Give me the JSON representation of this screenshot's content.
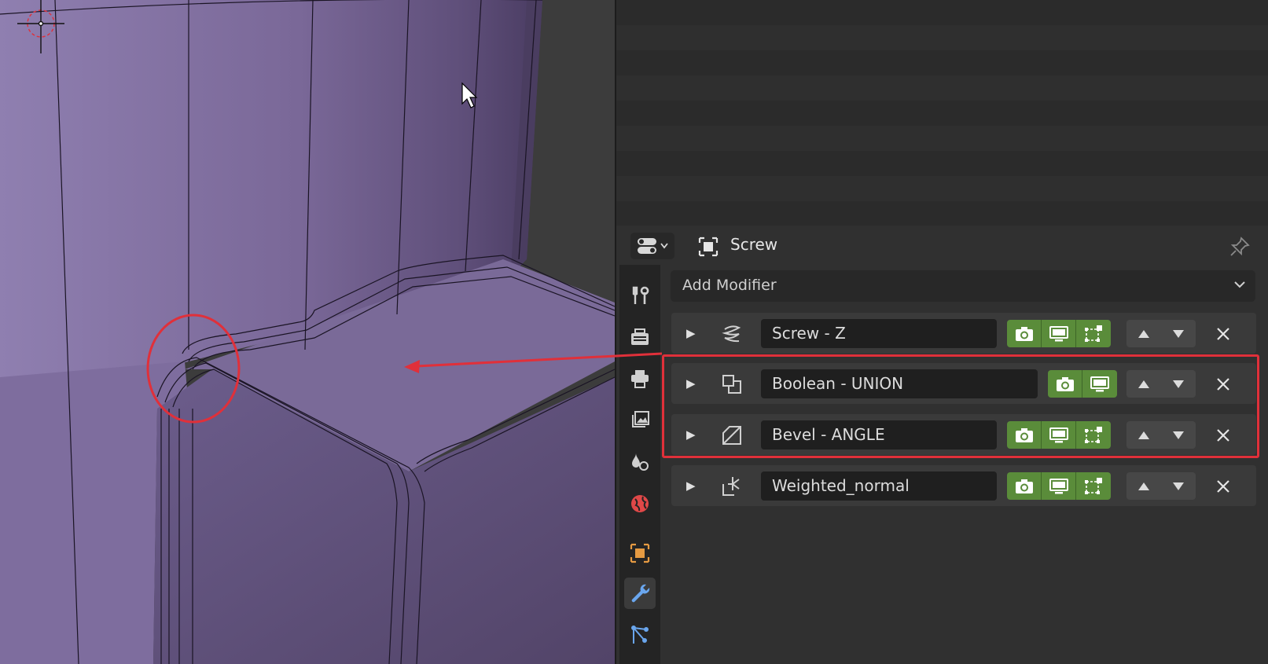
{
  "properties": {
    "object_name": "Screw",
    "add_modifier_label": "Add Modifier",
    "modifiers": [
      {
        "name": "Screw - Z",
        "icon": "screw-modifier-icon",
        "toggles": [
          "render-camera-icon",
          "viewport-display-icon",
          "edit-mode-icon"
        ]
      },
      {
        "name": "Boolean - UNION",
        "icon": "boolean-modifier-icon",
        "toggles": [
          "render-camera-icon",
          "viewport-display-icon"
        ]
      },
      {
        "name": "Bevel - ANGLE",
        "icon": "bevel-modifier-icon",
        "toggles": [
          "render-camera-icon",
          "viewport-display-icon",
          "edit-mode-icon"
        ]
      },
      {
        "name": "Weighted_normal",
        "icon": "weighted-normal-modifier-icon",
        "toggles": [
          "render-camera-icon",
          "viewport-display-icon",
          "edit-mode-icon"
        ]
      }
    ],
    "tabs": [
      "tool",
      "render",
      "output",
      "view-layer",
      "scene",
      "world",
      "object",
      "modifiers",
      "particles"
    ],
    "active_tab": "modifiers"
  },
  "colors": {
    "panel_bg": "#303030",
    "toggle_green": "#5a8c3a",
    "annotation_red": "#e0303a",
    "mesh_purple": "#7c6a98"
  }
}
